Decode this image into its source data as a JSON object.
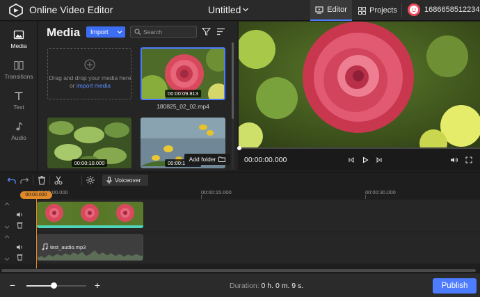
{
  "app": {
    "title": "Online Video Editor",
    "project_title": "Untitled",
    "accent_color": "#4d7cfe",
    "tabs": [
      {
        "label": "Editor",
        "icon": "editor-icon",
        "active": true
      },
      {
        "label": "Projects",
        "icon": "grid-icon",
        "active": false
      }
    ],
    "user_id": "1686658512234"
  },
  "left_nav": [
    {
      "label": "Media",
      "icon": "media-image-icon",
      "active": true
    },
    {
      "label": "Transitions",
      "icon": "transitions-icon",
      "active": false
    },
    {
      "label": "Text",
      "icon": "text-icon",
      "active": false
    },
    {
      "label": "Audio",
      "icon": "music-note-icon",
      "active": false
    }
  ],
  "media": {
    "heading": "Media",
    "import_label": "Import",
    "search_placeholder": "Search",
    "dropzone_text": "Drag and drop your media here or",
    "dropzone_link": "import media",
    "add_folder_label": "Add folder",
    "items": [
      {
        "name": "180825_02_02.mp4",
        "duration": "00:00:09.813",
        "selected": true
      },
      {
        "name": "",
        "duration": "00:00:10.000",
        "selected": false
      },
      {
        "name": "",
        "duration": "00:00:10.000",
        "selected": false
      }
    ]
  },
  "player": {
    "current_time": "00:00:00.000",
    "controls": [
      "prev-frame-icon",
      "play-icon",
      "next-frame-icon",
      "volume-icon",
      "fullscreen-icon"
    ]
  },
  "timeline": {
    "voiceover_label": "Voiceover",
    "playhead_time": "00:00.000",
    "ruler_labels": [
      "00:00:00.000",
      "00:00:15.000",
      "00:00:30.000"
    ],
    "video_clip_count": 3,
    "audio_clip_name": "test_audio.mp3"
  },
  "bottom": {
    "duration_label": "Duration:",
    "duration_value": "0 h. 0 m. 9 s.",
    "publish_label": "Publish",
    "zoom_level": 0.45
  }
}
